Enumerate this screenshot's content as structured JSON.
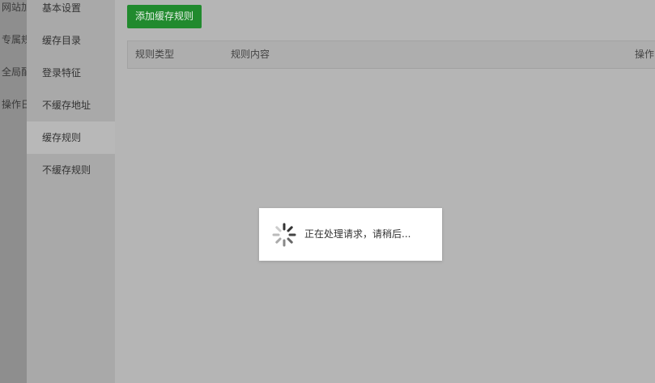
{
  "outer_nav": {
    "items": [
      "网站加",
      "专属规",
      "全局配",
      "操作日"
    ]
  },
  "sidebar": {
    "items": [
      {
        "label": "基本设置"
      },
      {
        "label": "缓存目录"
      },
      {
        "label": "登录特征"
      },
      {
        "label": "不缓存地址"
      },
      {
        "label": "缓存规则",
        "active": true
      },
      {
        "label": "不缓存规则"
      }
    ]
  },
  "toolbar": {
    "add_label": "添加缓存规则"
  },
  "table": {
    "columns": [
      "规则类型",
      "规则内容",
      "操作"
    ]
  },
  "loading": {
    "text": "正在处理请求，请稍后..."
  },
  "colors": {
    "accent_green": "#218a2e"
  }
}
